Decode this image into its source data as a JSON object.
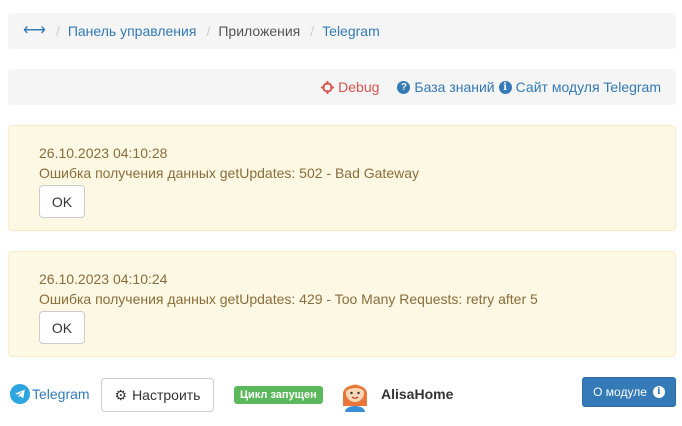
{
  "breadcrumb": {
    "home_icon": "arrows-horizontal-icon",
    "items": [
      "Панель управления",
      "Приложения",
      "Telegram"
    ],
    "separator": "/"
  },
  "toolbar": {
    "debug_label": "Debug",
    "kb_label": "База знаний",
    "site_label": "Сайт модуля Telegram",
    "debug_color": "#d9534f",
    "link_color": "#337ab7"
  },
  "alerts": [
    {
      "timestamp": "26.10.2023 04:10:28",
      "message": "Ошибка получения данных getUpdates: 502 - Bad Gateway",
      "button": "OK"
    },
    {
      "timestamp": "26.10.2023 04:10:24",
      "message": "Ошибка получения данных getUpdates: 429 - Too Many Requests: retry after 5",
      "button": "OK"
    }
  ],
  "footer": {
    "module_label": "Telegram",
    "setup_label": "Настроить",
    "cycle_status": "Цикл запущен",
    "user_name": "AlisaHome",
    "about_label": "О модуле",
    "badge_color": "#5cb85c",
    "primary_color": "#337ab7"
  }
}
